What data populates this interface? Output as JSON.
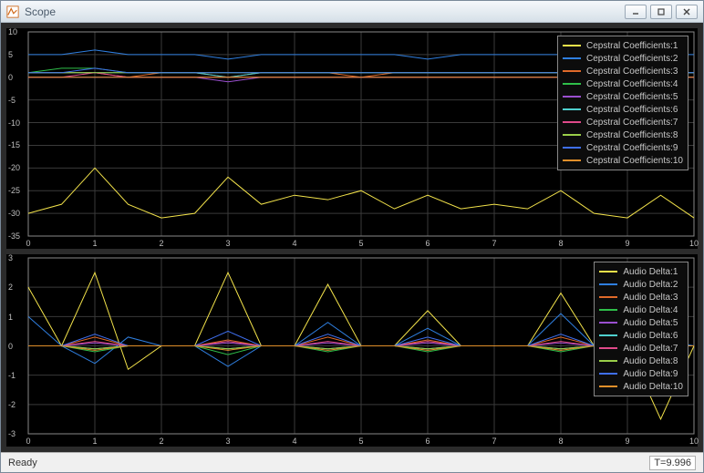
{
  "window": {
    "title": "Scope"
  },
  "status": {
    "left": "Ready",
    "right": "T=9.996"
  },
  "colors": {
    "series": [
      "#f2e24a",
      "#2f7fe0",
      "#e06a2a",
      "#2fbf4a",
      "#9a4fcf",
      "#4fd0cf",
      "#e04a8a",
      "#9acf4a",
      "#3f6fef",
      "#e08f2a"
    ]
  },
  "chart_data": [
    {
      "type": "line",
      "title": "",
      "xlabel": "",
      "ylabel": "",
      "xlim": [
        0,
        10
      ],
      "ylim": [
        -35,
        10
      ],
      "yticks": [
        -35,
        -30,
        -25,
        -20,
        -15,
        -10,
        -5,
        0,
        5,
        10
      ],
      "xticks": [
        0,
        1,
        2,
        3,
        4,
        5,
        6,
        7,
        8,
        9,
        10
      ],
      "x": [
        0,
        0.5,
        1,
        1.5,
        2,
        2.5,
        3,
        3.5,
        4,
        4.5,
        5,
        5.5,
        6,
        6.5,
        7,
        7.5,
        8,
        8.5,
        9,
        9.5,
        10
      ],
      "series": [
        {
          "name": "Cepstral Coefficients:1",
          "values": [
            -30,
            -28,
            -20,
            -28,
            -31,
            -30,
            -22,
            -28,
            -26,
            -27,
            -25,
            -29,
            -26,
            -29,
            -28,
            -29,
            -25,
            -30,
            -31,
            -26,
            -31
          ]
        },
        {
          "name": "Cepstral Coefficients:2",
          "values": [
            5,
            5,
            6,
            5,
            5,
            5,
            4,
            5,
            5,
            5,
            5,
            5,
            4,
            5,
            5,
            5,
            5,
            5,
            5,
            5,
            5
          ]
        },
        {
          "name": "Cepstral Coefficients:3",
          "values": [
            1,
            1,
            1,
            0,
            1,
            1,
            0,
            1,
            1,
            1,
            0,
            1,
            1,
            1,
            1,
            1,
            1,
            1,
            1,
            1,
            1
          ]
        },
        {
          "name": "Cepstral Coefficients:4",
          "values": [
            1,
            2,
            2,
            1,
            1,
            1,
            1,
            1,
            1,
            1,
            1,
            1,
            1,
            1,
            1,
            1,
            1,
            1,
            1,
            1,
            1
          ]
        },
        {
          "name": "Cepstral Coefficients:5",
          "values": [
            0,
            0,
            0,
            0,
            0,
            0,
            -1,
            0,
            0,
            0,
            0,
            0,
            0,
            0,
            0,
            0,
            0,
            0,
            0,
            0,
            0
          ]
        },
        {
          "name": "Cepstral Coefficients:6",
          "values": [
            1,
            1,
            1,
            1,
            1,
            1,
            0,
            1,
            1,
            1,
            1,
            1,
            1,
            1,
            1,
            1,
            1,
            1,
            1,
            1,
            1
          ]
        },
        {
          "name": "Cepstral Coefficients:7",
          "values": [
            0,
            0,
            1,
            0,
            0,
            0,
            0,
            0,
            0,
            0,
            0,
            0,
            0,
            0,
            0,
            0,
            0,
            0,
            0,
            0,
            0
          ]
        },
        {
          "name": "Cepstral Coefficients:8",
          "values": [
            1,
            1,
            1,
            1,
            1,
            1,
            1,
            1,
            1,
            1,
            1,
            1,
            1,
            1,
            1,
            1,
            1,
            1,
            1,
            1,
            1
          ]
        },
        {
          "name": "Cepstral Coefficients:9",
          "values": [
            1,
            1,
            2,
            1,
            1,
            1,
            1,
            1,
            1,
            1,
            1,
            1,
            1,
            1,
            1,
            1,
            1,
            1,
            1,
            1,
            1
          ]
        },
        {
          "name": "Cepstral Coefficients:10",
          "values": [
            0,
            0,
            0,
            0,
            0,
            0,
            0,
            0,
            0,
            0,
            0,
            0,
            0,
            0,
            0,
            0,
            0,
            0,
            0,
            0,
            0
          ]
        }
      ]
    },
    {
      "type": "line",
      "title": "",
      "xlabel": "",
      "ylabel": "",
      "xlim": [
        0,
        10
      ],
      "ylim": [
        -3,
        3
      ],
      "yticks": [
        -3,
        -2,
        -1,
        0,
        1,
        2,
        3
      ],
      "xticks": [
        0,
        1,
        2,
        3,
        4,
        5,
        6,
        7,
        8,
        9,
        10
      ],
      "x": [
        0,
        0.5,
        1,
        1.5,
        2,
        2.5,
        3,
        3.5,
        4,
        4.5,
        5,
        5.5,
        6,
        6.5,
        7,
        7.5,
        8,
        8.5,
        9,
        9.5,
        10
      ],
      "series": [
        {
          "name": "Audio Delta:1",
          "values": [
            2,
            0,
            2.5,
            -0.8,
            0,
            0,
            2.5,
            0,
            0,
            2.1,
            0,
            0,
            1.2,
            0,
            0,
            0,
            1.8,
            0,
            0,
            -2.5,
            0
          ]
        },
        {
          "name": "Audio Delta:2",
          "values": [
            1,
            0,
            -0.6,
            0.3,
            0,
            0,
            -0.7,
            0,
            0,
            0.8,
            0,
            0,
            0.6,
            0,
            0,
            0,
            1.1,
            0,
            0,
            0.2,
            0
          ]
        },
        {
          "name": "Audio Delta:3",
          "values": [
            0,
            0,
            0.3,
            0,
            0,
            0,
            0.2,
            0,
            0,
            0.3,
            0,
            0,
            0.2,
            0,
            0,
            0,
            0.3,
            0,
            0,
            0,
            0
          ]
        },
        {
          "name": "Audio Delta:4",
          "values": [
            0,
            0,
            -0.2,
            0,
            0,
            0,
            -0.3,
            0,
            0,
            -0.2,
            0,
            0,
            -0.2,
            0,
            0,
            0,
            -0.2,
            0,
            0,
            0,
            0
          ]
        },
        {
          "name": "Audio Delta:5",
          "values": [
            0,
            0,
            0.1,
            0,
            0,
            0,
            0.1,
            0,
            0,
            0.1,
            0,
            0,
            0.1,
            0,
            0,
            0,
            0.1,
            0,
            0,
            0,
            0
          ]
        },
        {
          "name": "Audio Delta:6",
          "values": [
            0,
            0,
            -0.1,
            0,
            0,
            0,
            -0.1,
            0,
            0,
            -0.1,
            0,
            0,
            -0.1,
            0,
            0,
            0,
            -0.1,
            0,
            0,
            0,
            0
          ]
        },
        {
          "name": "Audio Delta:7",
          "values": [
            0,
            0,
            0.15,
            0,
            0,
            0,
            0.15,
            0,
            0,
            0.15,
            0,
            0,
            0.15,
            0,
            0,
            0,
            0.15,
            0,
            0,
            0,
            0
          ]
        },
        {
          "name": "Audio Delta:8",
          "values": [
            0,
            0,
            -0.1,
            0,
            0,
            0,
            -0.1,
            0,
            0,
            -0.1,
            0,
            0,
            -0.1,
            0,
            0,
            0,
            -0.1,
            0,
            0,
            0,
            0
          ]
        },
        {
          "name": "Audio Delta:9",
          "values": [
            0,
            0,
            0.4,
            0,
            0,
            0,
            0.5,
            0,
            0,
            0.4,
            0,
            0,
            0.3,
            0,
            0,
            0,
            0.4,
            0,
            0,
            0,
            0
          ]
        },
        {
          "name": "Audio Delta:10",
          "values": [
            0,
            0,
            -0.15,
            0,
            0,
            0,
            -0.15,
            0,
            0,
            -0.15,
            0,
            0,
            -0.15,
            0,
            0,
            0,
            -0.15,
            0,
            0,
            0,
            0
          ]
        }
      ]
    }
  ]
}
